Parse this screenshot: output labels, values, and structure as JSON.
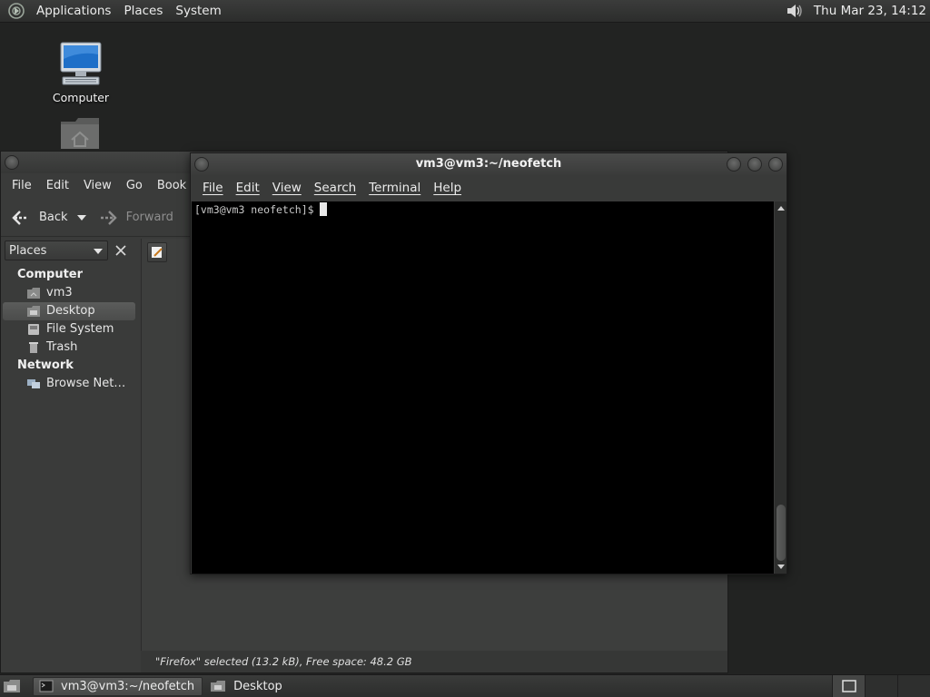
{
  "top_panel": {
    "menus": [
      "Applications",
      "Places",
      "System"
    ],
    "clock": "Thu Mar 23, 14:12"
  },
  "desktop": {
    "icons": [
      {
        "label": "Computer"
      },
      {
        "label": ""
      }
    ]
  },
  "file_manager": {
    "menus": [
      "File",
      "Edit",
      "View",
      "Go",
      "Book"
    ],
    "toolbar": {
      "back": "Back",
      "forward": "Forward"
    },
    "sidebar": {
      "combo_label": "Places",
      "sections": [
        {
          "heading": "Computer",
          "items": [
            "vm3",
            "Desktop",
            "File System",
            "Trash"
          ]
        },
        {
          "heading": "Network",
          "items": [
            "Browse Net…"
          ]
        }
      ]
    },
    "status": "\"Firefox\" selected (13.2 kB), Free space: 48.2 GB"
  },
  "terminal": {
    "title": "vm3@vm3:~/neofetch",
    "menus": [
      "File",
      "Edit",
      "View",
      "Search",
      "Terminal",
      "Help"
    ],
    "prompt": "[vm3@vm3 neofetch]$"
  },
  "taskbar": {
    "tasks": [
      {
        "label": "vm3@vm3:~/neofetch",
        "active": true
      },
      {
        "label": "Desktop",
        "active": false
      }
    ]
  }
}
